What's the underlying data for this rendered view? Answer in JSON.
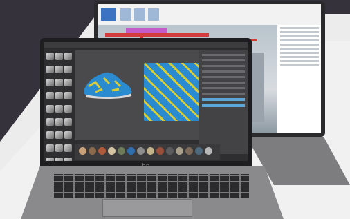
{
  "image": {
    "description_tag": "two-laptops-product-photo",
    "colors": {
      "background_dark": "#35323b",
      "background_light": "#ececec",
      "laptop_body": "#8a8a8d",
      "screen_bezel": "#1e1e20",
      "fabric_blue": "#2a8bd1",
      "fabric_yellow": "#d8cd33",
      "pipe_red": "#d43b3b",
      "duct_magenta": "#c55ac9"
    },
    "icons": {
      "brand_logo": "hp-logo-icon"
    },
    "front_laptop": {
      "logo_text": "hp"
    }
  }
}
